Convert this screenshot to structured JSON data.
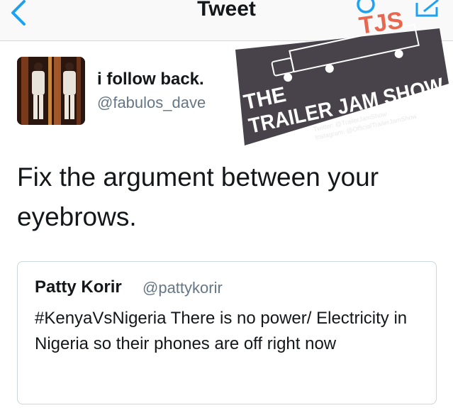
{
  "navbar": {
    "title": "Tweet",
    "back_icon": "chevron-left-icon",
    "search_icon": "search-icon",
    "compose_icon": "compose-icon",
    "accent_color": "#1da1f2"
  },
  "tweet": {
    "author_name": "i follow back.",
    "author_handle": "@fabulos_dave",
    "text": "Fix the argument between your eyebrows."
  },
  "quoted_tweet": {
    "author_name": "Patty Korir",
    "author_handle": "@pattykorir",
    "text": "#KenyaVsNigeria There is no power/ Electricity in Nigeria so their phones are off right now"
  },
  "watermark": {
    "badge": "TJS",
    "title_line1": "THE",
    "title_line2": "TRAILER JAM SHOW",
    "twitter_line": "Twitter: @TrailerJamShow",
    "instagram_line": "Instagram: @OfficialTrailerJamShow",
    "badge_color": "#e8674f",
    "bg_color": "#4a4548"
  },
  "colors": {
    "text": "#14171a",
    "secondary": "#657786",
    "border": "#ccd6dd"
  }
}
